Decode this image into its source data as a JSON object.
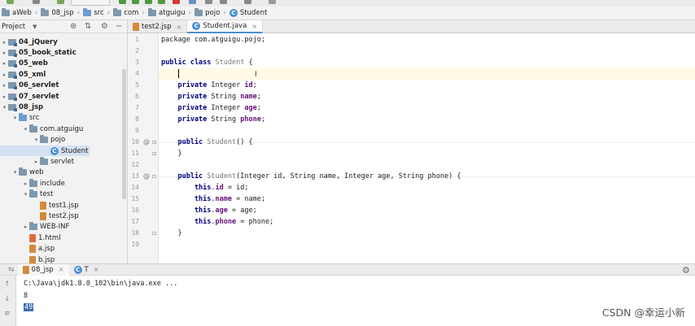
{
  "breadcrumb": [
    {
      "label": "aWeb",
      "icon": "module-folder-icon"
    },
    {
      "label": "08_jsp",
      "icon": "module-folder-icon"
    },
    {
      "label": "src",
      "icon": "source-folder-icon"
    },
    {
      "label": "com",
      "icon": "package-folder-icon"
    },
    {
      "label": "atguigu",
      "icon": "package-folder-icon"
    },
    {
      "label": "pojo",
      "icon": "package-folder-icon"
    },
    {
      "label": "Student",
      "icon": "class-icon"
    }
  ],
  "project_panel": {
    "title": "Project",
    "tree": [
      {
        "label": "04_jQuery",
        "icon": "module-icon",
        "arrow": "▸",
        "depth": 0,
        "bold": true
      },
      {
        "label": "05_book_static",
        "icon": "module-icon",
        "arrow": "▸",
        "depth": 0,
        "bold": true
      },
      {
        "label": "05_web",
        "icon": "module-icon",
        "arrow": "▸",
        "depth": 0,
        "bold": true
      },
      {
        "label": "05_xml",
        "icon": "module-icon",
        "arrow": "▸",
        "depth": 0,
        "bold": true
      },
      {
        "label": "06_servlet",
        "icon": "module-icon",
        "arrow": "▸",
        "depth": 0,
        "bold": true
      },
      {
        "label": "07_servlet",
        "icon": "module-icon",
        "arrow": "▸",
        "depth": 0,
        "bold": true
      },
      {
        "label": "08_jsp",
        "icon": "module-icon",
        "arrow": "▾",
        "depth": 0,
        "bold": true
      },
      {
        "label": "src",
        "icon": "source-folder-icon",
        "arrow": "▾",
        "depth": 1
      },
      {
        "label": "com.atguigu",
        "icon": "package-folder-icon",
        "arrow": "▾",
        "depth": 2
      },
      {
        "label": "pojo",
        "icon": "package-folder-icon",
        "arrow": "▾",
        "depth": 3
      },
      {
        "label": "Student",
        "icon": "class-icon",
        "arrow": "",
        "depth": 4,
        "selected": true
      },
      {
        "label": "servlet",
        "icon": "package-folder-icon",
        "arrow": "▸",
        "depth": 3
      },
      {
        "label": "web",
        "icon": "folder-icon",
        "arrow": "▾",
        "depth": 1
      },
      {
        "label": "include",
        "icon": "folder-icon",
        "arrow": "▸",
        "depth": 2
      },
      {
        "label": "test",
        "icon": "folder-icon",
        "arrow": "▾",
        "depth": 2
      },
      {
        "label": "test1.jsp",
        "icon": "jsp-file-icon",
        "arrow": "",
        "depth": 3
      },
      {
        "label": "test2.jsp",
        "icon": "jsp-file-icon",
        "arrow": "",
        "depth": 3
      },
      {
        "label": "WEB-INF",
        "icon": "folder-icon",
        "arrow": "▸",
        "depth": 2
      },
      {
        "label": "1.html",
        "icon": "html-file-icon",
        "arrow": "",
        "depth": 2
      },
      {
        "label": "a.jsp",
        "icon": "jsp-file-icon",
        "arrow": "",
        "depth": 2
      },
      {
        "label": "b.jsp",
        "icon": "jsp-file-icon",
        "arrow": "",
        "depth": 2
      }
    ]
  },
  "editor_tabs": [
    {
      "label": "test2.jsp",
      "icon": "jsp-file-icon",
      "active": false
    },
    {
      "label": "Student.java",
      "icon": "class-icon",
      "active": true
    }
  ],
  "editor": {
    "current_line": 4,
    "lines": [
      {
        "n": "1",
        "code": [
          {
            "t": "package com.atguigu.pojo;",
            "c": "kw-pkg"
          }
        ]
      },
      {
        "n": "2",
        "code": []
      },
      {
        "n": "3",
        "code": [
          {
            "t": "public class ",
            "c": "kw"
          },
          {
            "t": "Student",
            "c": "cls-gray"
          },
          {
            "t": " {",
            "c": ""
          }
        ]
      },
      {
        "n": "4",
        "code": []
      },
      {
        "n": "5",
        "code": [
          {
            "t": "    private ",
            "c": "kw"
          },
          {
            "t": "Integer ",
            "c": ""
          },
          {
            "t": "id",
            "c": "fld"
          },
          {
            "t": ";",
            "c": ""
          }
        ]
      },
      {
        "n": "6",
        "code": [
          {
            "t": "    private ",
            "c": "kw"
          },
          {
            "t": "String ",
            "c": ""
          },
          {
            "t": "name",
            "c": "fld"
          },
          {
            "t": ";",
            "c": ""
          }
        ]
      },
      {
        "n": "7",
        "code": [
          {
            "t": "    private ",
            "c": "kw"
          },
          {
            "t": "Integer ",
            "c": ""
          },
          {
            "t": "age",
            "c": "fld"
          },
          {
            "t": ";",
            "c": ""
          }
        ]
      },
      {
        "n": "8",
        "code": [
          {
            "t": "    private ",
            "c": "kw"
          },
          {
            "t": "String ",
            "c": ""
          },
          {
            "t": "phone",
            "c": "fld"
          },
          {
            "t": ";",
            "c": ""
          }
        ]
      },
      {
        "n": "9",
        "code": []
      },
      {
        "n": "10",
        "code": [
          {
            "t": "    public ",
            "c": "kw"
          },
          {
            "t": "Student",
            "c": "cls-gray"
          },
          {
            "t": "() {",
            "c": ""
          }
        ]
      },
      {
        "n": "11",
        "code": [
          {
            "t": "    }",
            "c": ""
          }
        ]
      },
      {
        "n": "12",
        "code": []
      },
      {
        "n": "13",
        "code": [
          {
            "t": "    public ",
            "c": "kw"
          },
          {
            "t": "Student",
            "c": "cls-gray"
          },
          {
            "t": "(Integer id, String name, Integer age, String phone) {",
            "c": ""
          }
        ]
      },
      {
        "n": "14",
        "code": [
          {
            "t": "        this",
            "c": "kw"
          },
          {
            "t": ".",
            "c": ""
          },
          {
            "t": "id",
            "c": "fld"
          },
          {
            "t": " = id;",
            "c": ""
          }
        ]
      },
      {
        "n": "15",
        "code": [
          {
            "t": "        this",
            "c": "kw"
          },
          {
            "t": ".",
            "c": ""
          },
          {
            "t": "name",
            "c": "fld"
          },
          {
            "t": " = name;",
            "c": ""
          }
        ]
      },
      {
        "n": "16",
        "code": [
          {
            "t": "        this",
            "c": "kw"
          },
          {
            "t": ".",
            "c": ""
          },
          {
            "t": "age",
            "c": "fld"
          },
          {
            "t": " = age;",
            "c": ""
          }
        ]
      },
      {
        "n": "17",
        "code": [
          {
            "t": "        this",
            "c": "kw"
          },
          {
            "t": ".",
            "c": ""
          },
          {
            "t": "phone",
            "c": "fld"
          },
          {
            "t": " = phone;",
            "c": ""
          }
        ]
      },
      {
        "n": "18",
        "code": [
          {
            "t": "    }",
            "c": ""
          }
        ]
      },
      {
        "n": "19",
        "code": []
      }
    ],
    "gutter_markers": [
      {
        "line": "10",
        "marker": "@"
      },
      {
        "line": "13",
        "marker": "@"
      }
    ]
  },
  "run_panel": {
    "tabs": [
      {
        "label": "08_jsp",
        "icon": "jsp-file-icon"
      },
      {
        "label": "T",
        "icon": "class-icon"
      }
    ],
    "console": {
      "command": "C:\\Java\\jdk1.8.0_102\\bin\\java.exe ...",
      "line2": "8",
      "value": "49"
    }
  },
  "watermark": "CSDN @幸运小新",
  "colors": {
    "keyword": "#000080",
    "field": "#660e7a",
    "selection": "#3c6fb1",
    "current_line": "#fffae3"
  }
}
